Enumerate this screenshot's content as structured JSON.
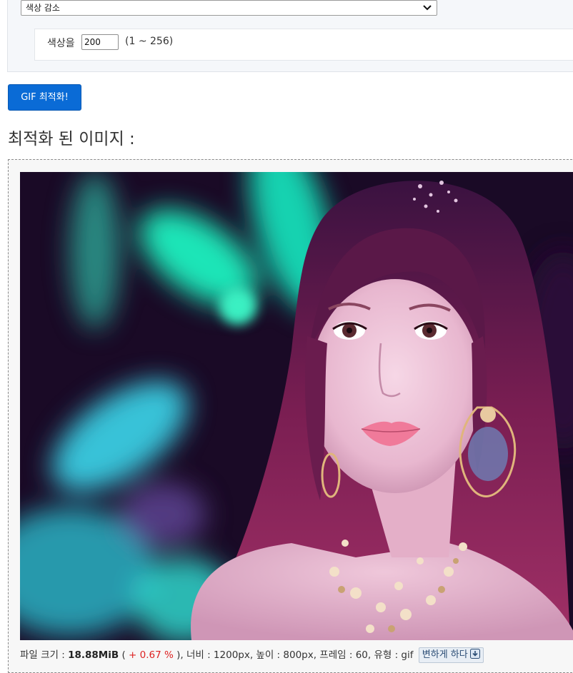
{
  "form": {
    "method_selected": "색상 감소",
    "colors_label": "색상을",
    "colors_value": "200",
    "colors_range": "(1 ~ 256)"
  },
  "optimize_button": "GIF 최적화!",
  "result": {
    "heading": "최적화 된 이미지 :",
    "info": {
      "size_label": "파일 크기 : ",
      "size_value": "18.88MiB",
      "open_paren": " ( ",
      "size_change": "+ 0.67 %",
      "close_and_width": " ), 너비 : 1200px, 높이 : 800px, 프레임 : 60, 유형 : gif",
      "convert_button": "변하게 하다"
    }
  },
  "icons": {
    "select_arrow": "chevron-down-icon",
    "download": "download-arrow-icon"
  },
  "colors": {
    "button_blue": "#0a6bd6",
    "percent_red": "#dd2222",
    "panel_bg": "#f5f7fa"
  }
}
